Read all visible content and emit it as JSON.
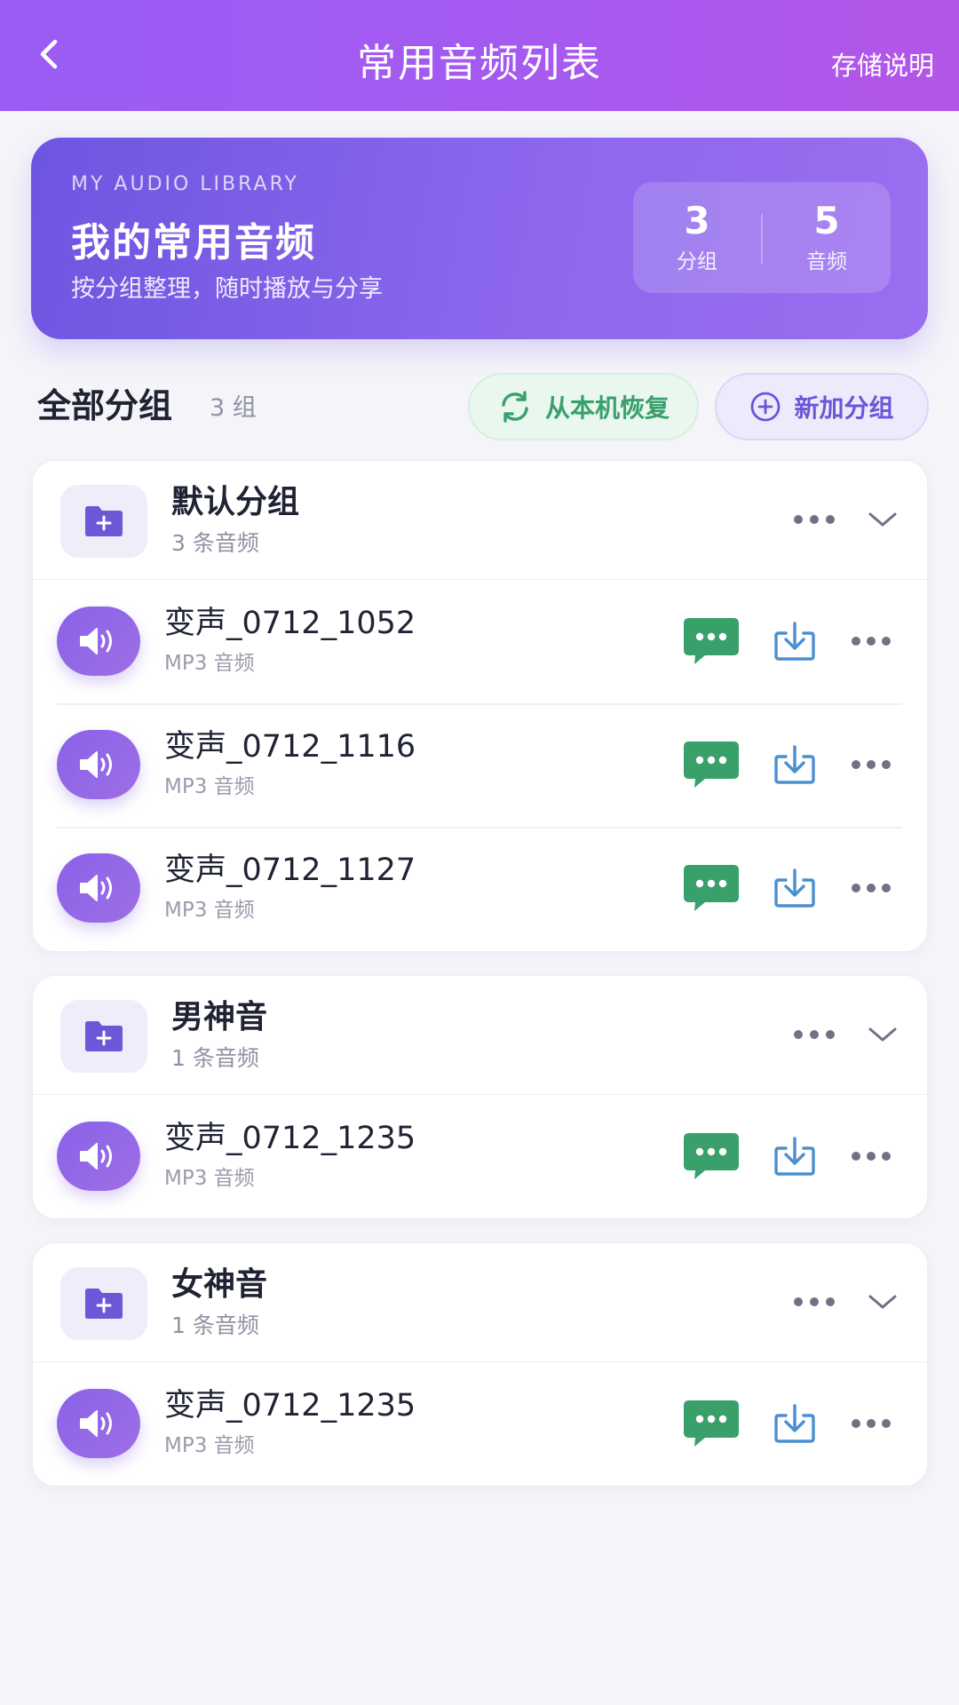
{
  "header": {
    "title": "常用音频列表",
    "right_link": "存储说明",
    "back_icon": "chevron-left-icon"
  },
  "hero": {
    "eyebrow": "MY AUDIO LIBRARY",
    "title": "我的常用音频",
    "subtitle": "按分组整理，随时播放与分享",
    "stats": [
      {
        "value": "3",
        "label": "分组"
      },
      {
        "value": "5",
        "label": "音频"
      }
    ]
  },
  "section": {
    "title": "全部分组",
    "count": "3 组",
    "restore_label": "从本机恢复",
    "add_label": "新加分组"
  },
  "colors": {
    "header_gradient_start": "#9a5cf5",
    "header_gradient_end": "#b356e8",
    "accent_purple": "#6a56d8",
    "share_green": "#3aa06b",
    "download_blue": "#4a8fcf"
  },
  "groups": [
    {
      "name": "默认分组",
      "count": "3 条音频",
      "items": [
        {
          "name": "变声_0712_1052",
          "type": "MP3 音频"
        },
        {
          "name": "变声_0712_1116",
          "type": "MP3 音频"
        },
        {
          "name": "变声_0712_1127",
          "type": "MP3 音频"
        }
      ]
    },
    {
      "name": "男神音",
      "count": "1 条音频",
      "items": [
        {
          "name": "变声_0712_1235",
          "type": "MP3 音频"
        }
      ]
    },
    {
      "name": "女神音",
      "count": "1 条音频",
      "items": [
        {
          "name": "变声_0712_1235",
          "type": "MP3 音频"
        }
      ]
    }
  ]
}
